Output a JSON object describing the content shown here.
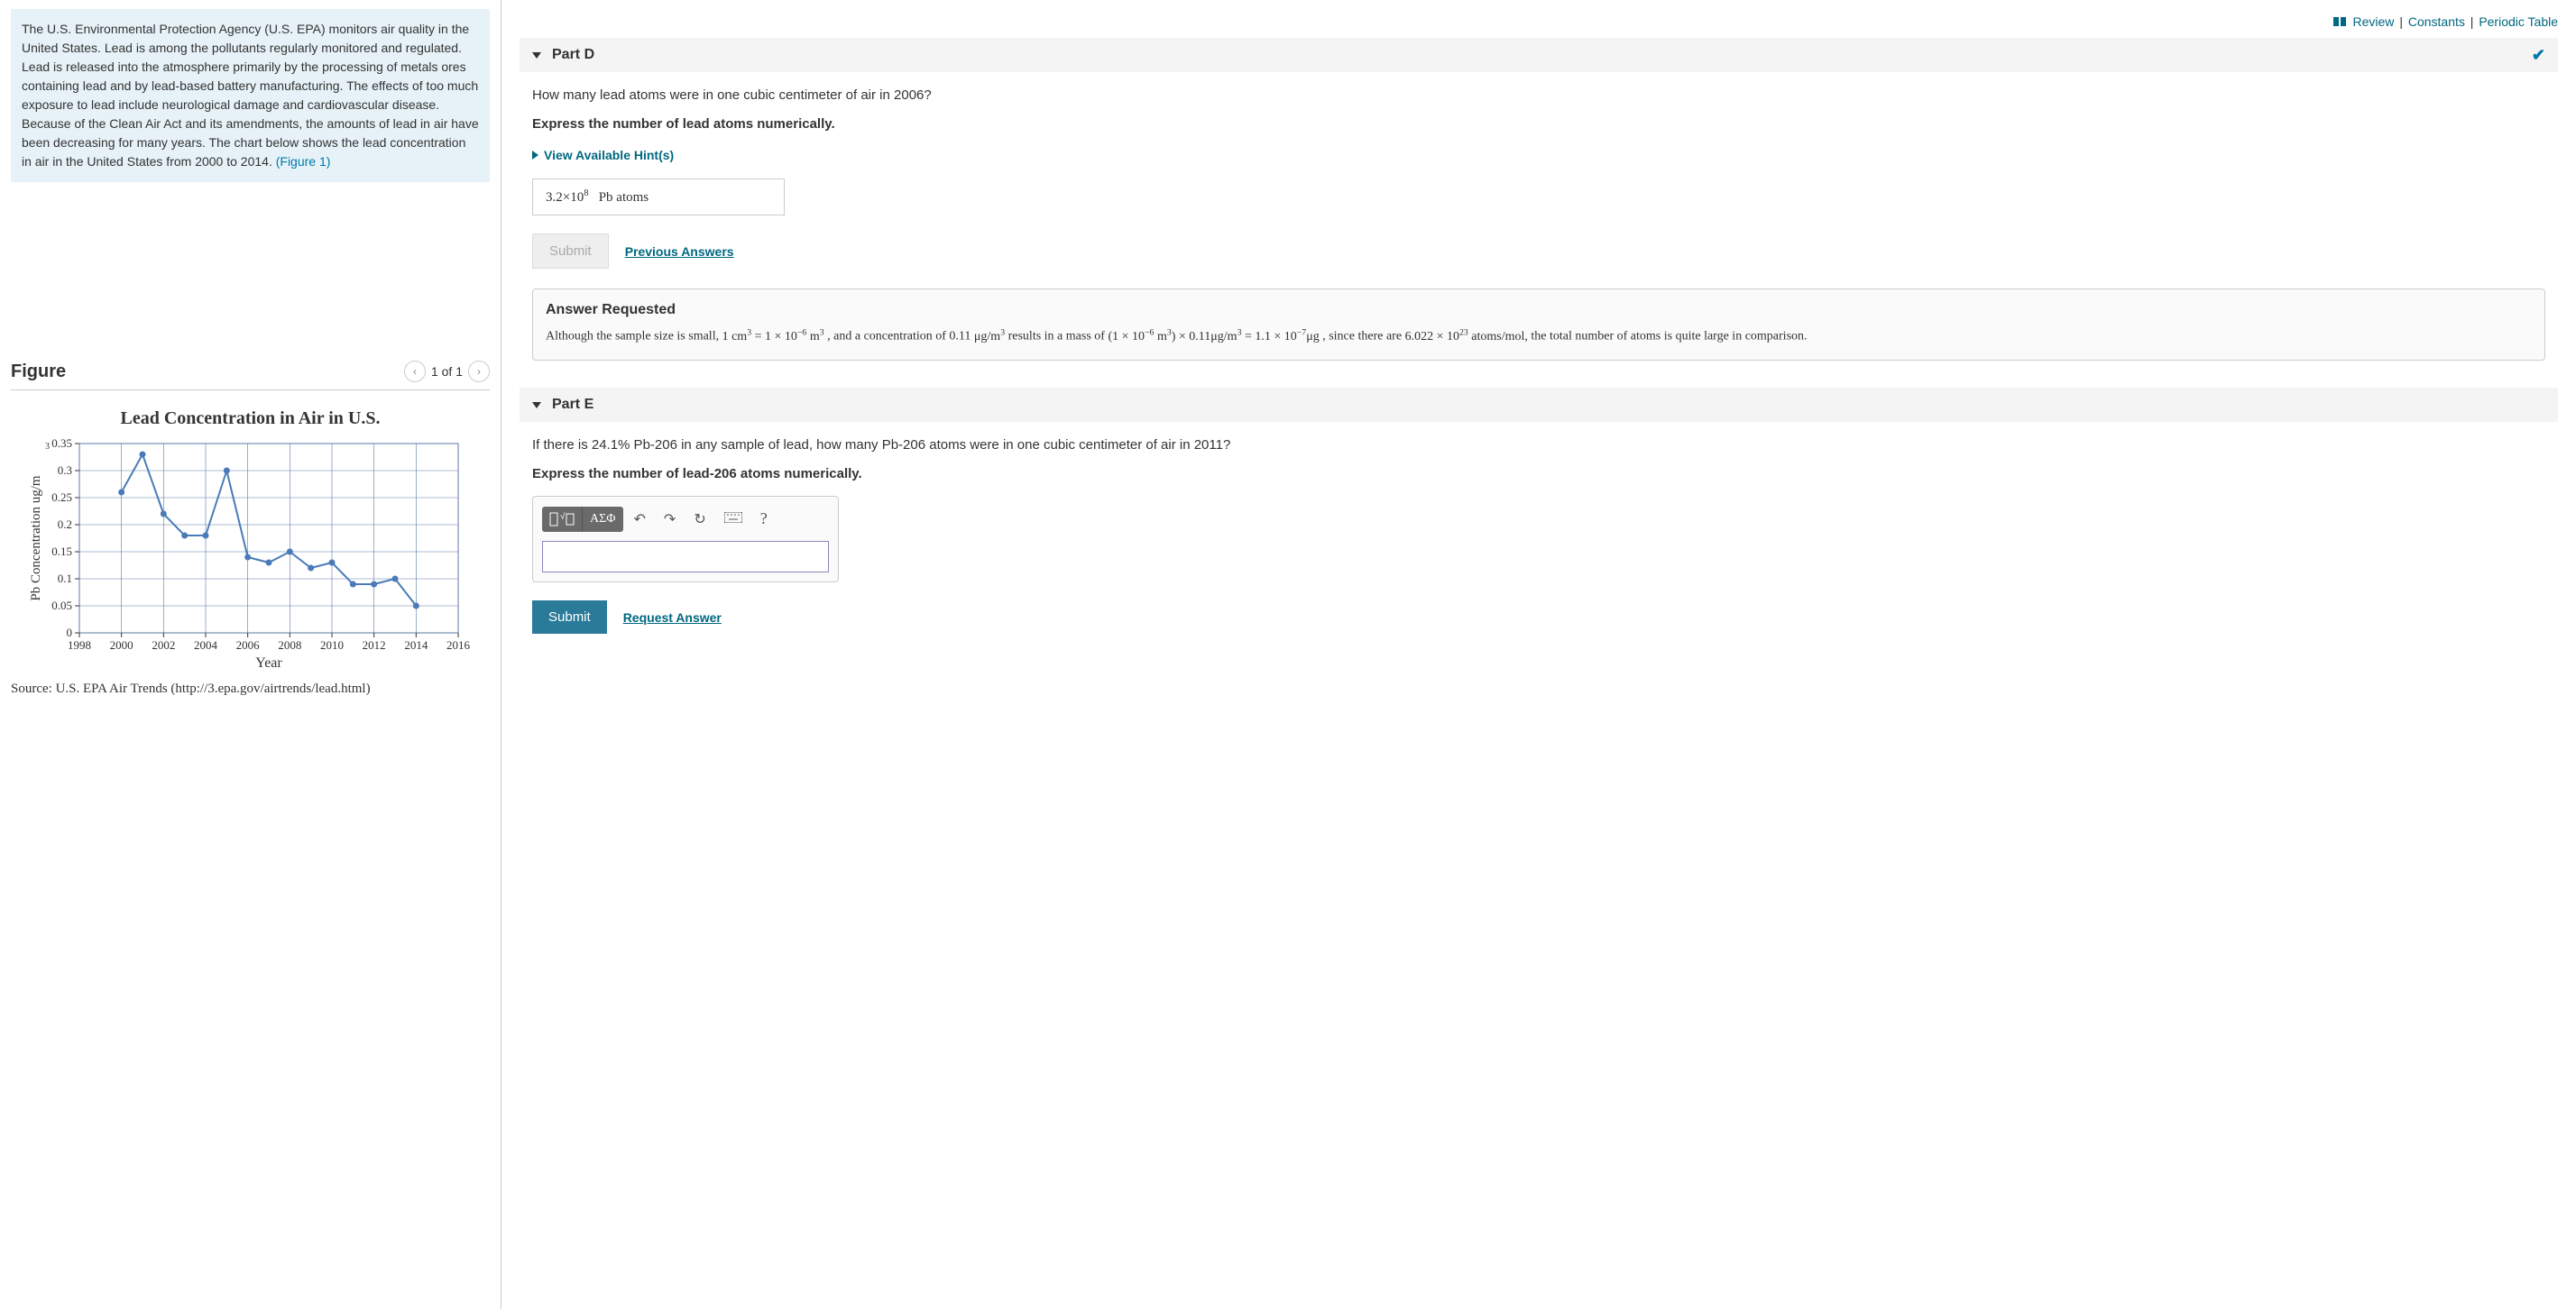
{
  "intro": {
    "text1": "The U.S. Environmental Protection Agency (U.S. EPA) monitors air quality in the United States. Lead is among the pollutants regularly monitored and regulated. Lead is released into the atmosphere primarily by the processing of metals ores containing lead and by lead-based battery manufacturing. The effects of too much exposure to lead include neurological damage and cardiovascular disease. Because of the Clean Air Act and its amendments, the amounts of lead in air have been decreasing for many years. The chart below shows the lead concentration in air in the United States from 2000 to 2014. ",
    "figure_link": "(Figure 1)"
  },
  "figure": {
    "heading": "Figure",
    "counter": "1 of 1",
    "title": "Lead Concentration in Air in U.S.",
    "source": "Source: U.S. EPA Air Trends (http://3.epa.gov/airtrends/lead.html)",
    "xlabel": "Year",
    "ylabel": "Pb Concentration ug/m"
  },
  "chart_data": {
    "type": "line",
    "title": "Lead Concentration in Air in U.S.",
    "xlabel": "Year",
    "ylabel": "Pb Concentration ug/m³",
    "xlim": [
      1998,
      2016
    ],
    "ylim": [
      0,
      0.35
    ],
    "x_ticks": [
      1998,
      2000,
      2002,
      2004,
      2006,
      2008,
      2010,
      2012,
      2014,
      2016
    ],
    "y_ticks": [
      0,
      0.05,
      0.1,
      0.15,
      0.2,
      0.25,
      0.3,
      0.35
    ],
    "x": [
      2000,
      2001,
      2002,
      2003,
      2004,
      2005,
      2006,
      2007,
      2008,
      2009,
      2010,
      2011,
      2012,
      2013,
      2014
    ],
    "y": [
      0.26,
      0.33,
      0.22,
      0.18,
      0.18,
      0.3,
      0.14,
      0.13,
      0.15,
      0.12,
      0.13,
      0.09,
      0.09,
      0.1,
      0.05
    ]
  },
  "top_links": {
    "review": "Review",
    "constants": "Constants",
    "periodic": "Periodic Table"
  },
  "partD": {
    "label": "Part D",
    "q": "How many lead atoms were in one cubic centimeter of air in 2006?",
    "instr": "Express the number of lead atoms numerically.",
    "hints": "View Available Hint(s)",
    "answer_prefix": "3.2×10",
    "answer_exp": "8",
    "answer_units": "Pb atoms",
    "submit": "Submit",
    "prev": "Previous Answers",
    "feedback_title": "Answer Requested",
    "feedback_line1a": "Although the sample size is small, ",
    "fb_m1": "1 cm",
    "fb_m1_exp": "3",
    "fb_eq1": " = 1 × 10",
    "fb_eq1_exp": "−6",
    "fb_m2": " m",
    "fb_m2_exp": "3",
    "fb_line1b": " , and a concentration of 0.11 ",
    "fb_mu1": "μg/m",
    "fb_mu1_exp": "3",
    "fb_line1c": " results in a mass of ",
    "fb_paren_open": "(1 × 10",
    "fb_paren_exp": "−6",
    "fb_paren_m": " m",
    "fb_paren_m_exp": "3",
    "fb_paren_close": ") × 0.11μg/m",
    "fb_paren_close_exp": "3",
    "fb_eq2": " = 1.1 × 10",
    "fb_eq2_exp": "−7",
    "fb_ug": "μg",
    "fb_line2a": " , since there are ",
    "fb_avog": "6.022 × 10",
    "fb_avog_exp": "23",
    "fb_atoms_mol": " atoms/mol,",
    "fb_line2b": " the total number of atoms is quite large in comparison."
  },
  "partE": {
    "label": "Part E",
    "q": "If there is 24.1% Pb-206 in any sample of lead, how many Pb-206 atoms were in one cubic centimeter of air in 2011?",
    "instr": "Express the number of lead-206 atoms numerically.",
    "tool_greek": "ΑΣΦ",
    "submit": "Submit",
    "request": "Request Answer",
    "help": "?"
  }
}
